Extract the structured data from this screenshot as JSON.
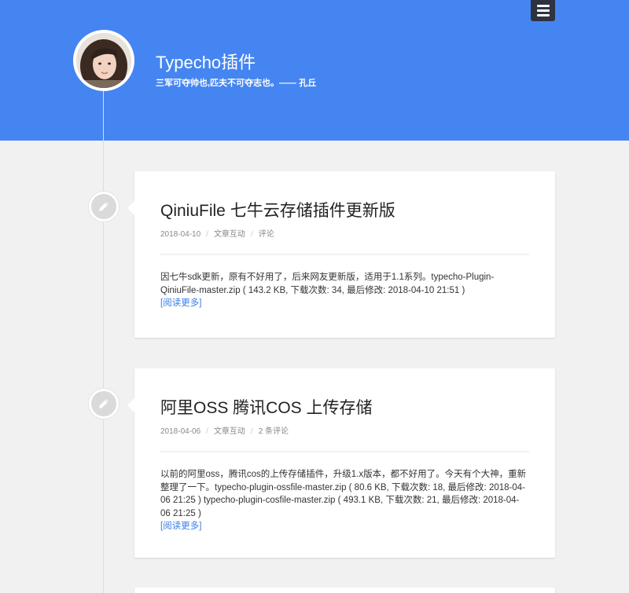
{
  "header": {
    "site_title": "Typecho插件",
    "site_desc": "三军可夺帅也,匹夫不可夺志也。—— 孔丘"
  },
  "posts": [
    {
      "title": "QiniuFile 七牛云存储插件更新版",
      "date": "2018-04-10",
      "category": "文章互动",
      "comments": "评论",
      "excerpt_lines": [
        "因七牛sdk更新，原有不好用了，后来网友更新版，适用于1.1系列。typecho-Plugin-",
        "QiniuFile-master.zip ( 143.2 KB, 下载次数: 34, 最后修改: 2018-04-10 21:51 )"
      ],
      "read_more": "[阅读更多]"
    },
    {
      "title": "阿里OSS 腾讯COS 上传存储",
      "date": "2018-04-06",
      "category": "文章互动",
      "comments": "2 条评论",
      "excerpt_lines": [
        "以前的阿里oss，腾讯cos的上传存储插件，升级1.x版本，都不好用了。今天有个大神，重新",
        "整理了一下。typecho-plugin-ossfile-master.zip ( 80.6 KB, 下载次数: 18, 最后修改: 2018-04-",
        "06 21:25 ) typecho-plugin-cosfile-master.zip ( 493.1 KB, 下载次数: 21, 最后修改: 2018-04-",
        "06 21:25 )"
      ],
      "read_more": "[阅读更多]"
    }
  ],
  "icons": {
    "menu": "hamburger-icon",
    "post": "pencil-icon"
  },
  "colors": {
    "header_bg": "#4585f1",
    "link": "#3b7de8",
    "page_bg": "#f1f1f1"
  }
}
